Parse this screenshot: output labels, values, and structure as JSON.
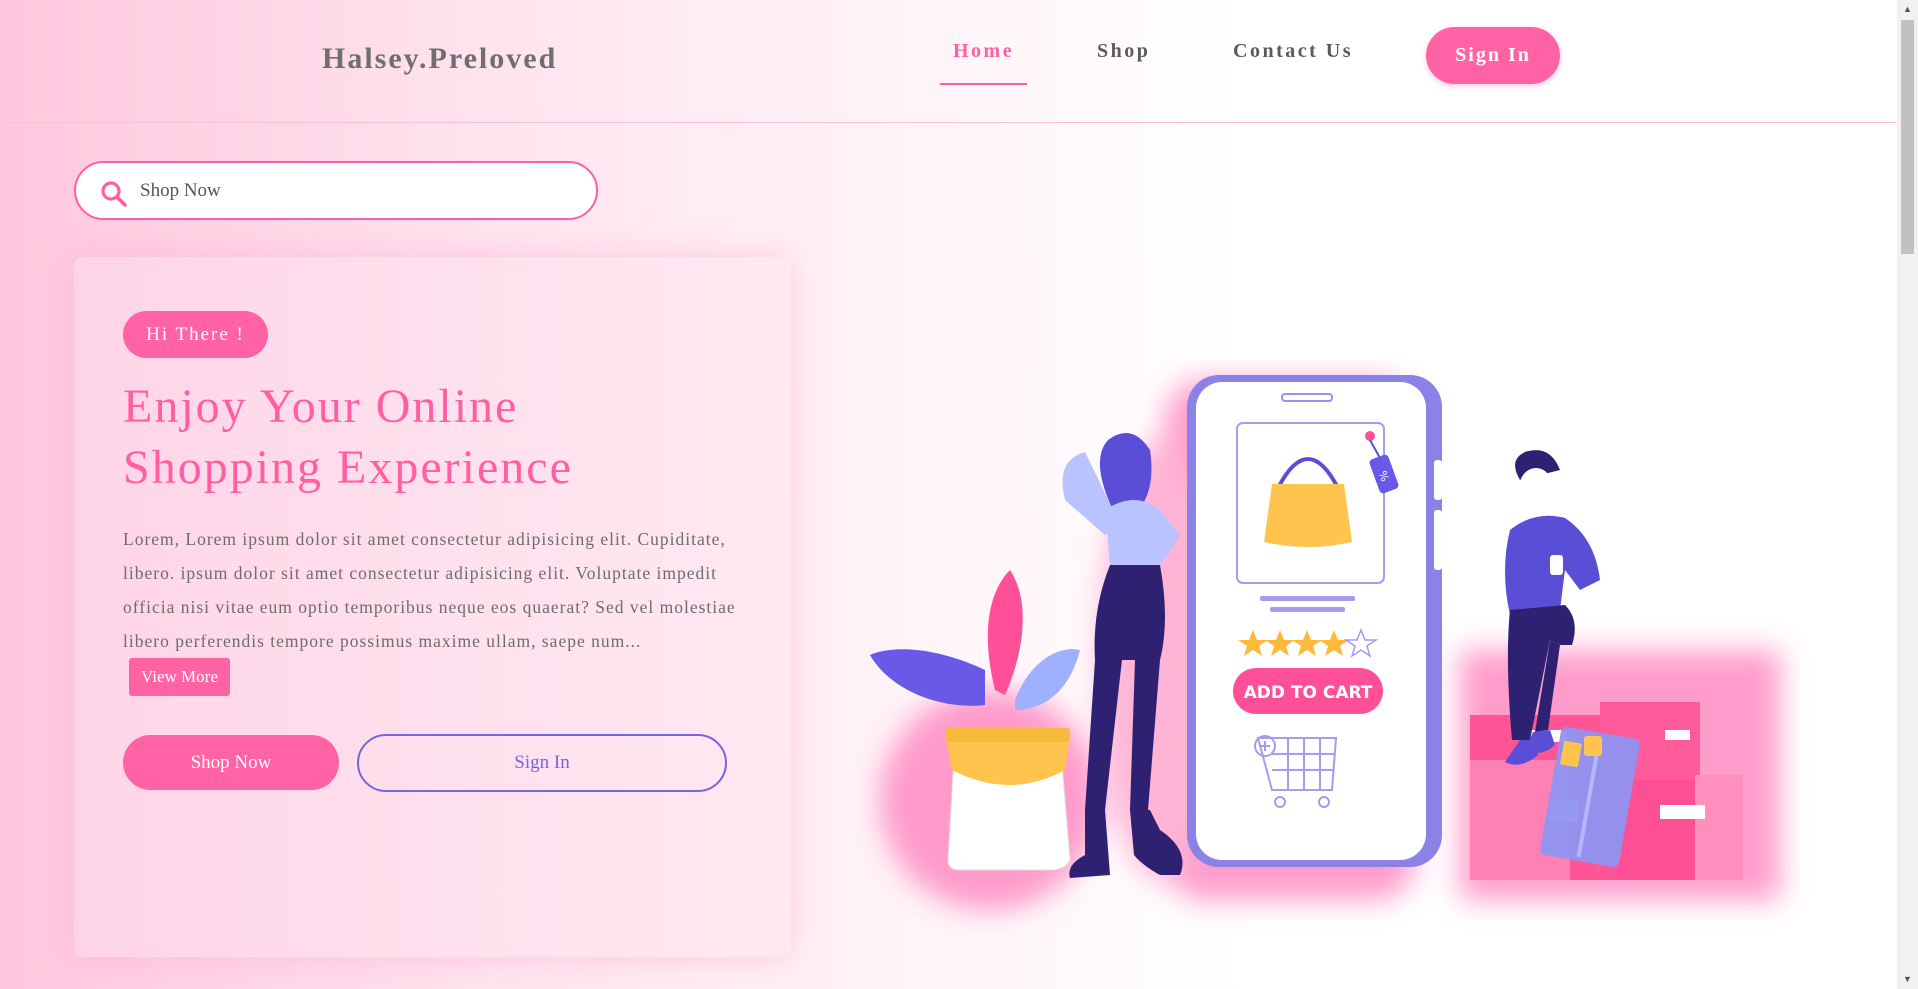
{
  "nav": {
    "brand": "Halsey.Preloved",
    "links": [
      "Home",
      "Shop",
      "Contact Us"
    ],
    "signin": "Sign In"
  },
  "search": {
    "placeholder": "Shop Now"
  },
  "hero": {
    "badge": "Hi There !",
    "title_line1": "Enjoy Your Online",
    "title_line2": "Shopping Experience",
    "body": "Lorem, Lorem ipsum dolor sit amet consectetur adipisicing elit. Cupiditate, libero. ipsum dolor sit amet consectetur adipisicing elit. Voluptate impedit officia nisi vitae eum optio temporibus neque eos quaerat? Sed vel molestiae libero perferendis tempore possimus maxime ullam, saepe num...",
    "view_more": "View More",
    "shop_now": "Shop Now",
    "sign_in": "Sign In"
  },
  "illustration": {
    "add_to_cart": "ADD TO CART",
    "tag": "%",
    "rating": "4 of 5"
  },
  "colors": {
    "accent": "#ff62a5",
    "secondary": "#7465e0",
    "text": "#6d6d6d"
  }
}
